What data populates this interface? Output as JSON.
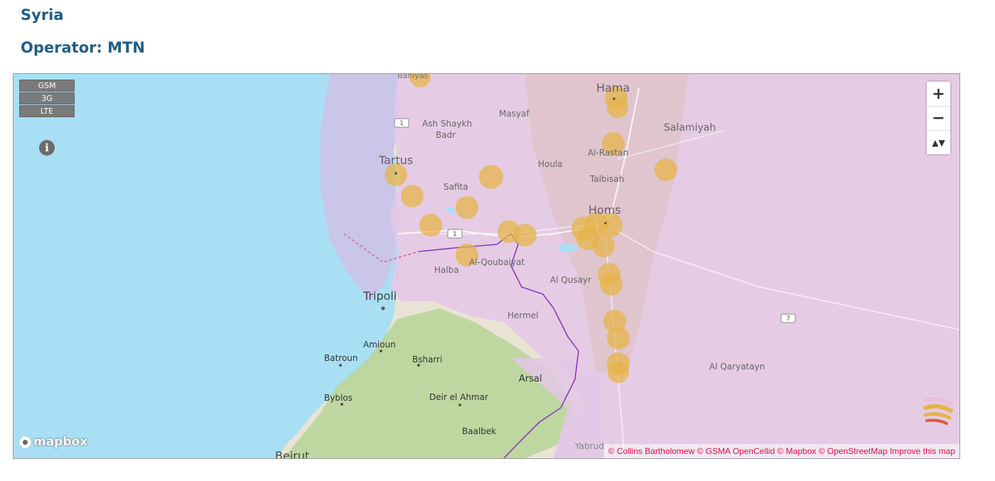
{
  "header": {
    "country": "Syria",
    "operator": "Operator: MTN"
  },
  "map": {
    "tech_buttons": [
      "GSM",
      "3G",
      "LTE"
    ],
    "info_glyph": "i",
    "zoom": {
      "in": "+",
      "out": "−",
      "compass": "▲▼"
    },
    "logo_text": "mapbox",
    "attribution": {
      "collins": "© Collins Bartholomew",
      "gsma": "© GSMA OpenCellid",
      "mapbox": "© Mapbox",
      "osm": "© OpenStreetMap",
      "improve": "Improve this map"
    },
    "places": {
      "baniyas": "Baniyas",
      "hama": "Hama",
      "masyaf": "Masyaf",
      "ash_shaykh_badr_1": "Ash Shaykh",
      "ash_shaykh_badr_2": "Badr",
      "salamiyah": "Salamiyah",
      "tartus": "Tartus",
      "al_rastan": "Al-Rastan",
      "houla": "Houla",
      "talbisah": "Talbisah",
      "safita": "Safita",
      "homs": "Homs",
      "al_qoubaiyat": "Al-Qoubaiyat",
      "halba": "Halba",
      "al_qusayr": "Al Qusayr",
      "tripoli": "Tripoli",
      "hermel": "Hermel",
      "amioun": "Amioun",
      "batroun": "Batroun",
      "bsharri": "Bsharri",
      "arsal": "Arsal",
      "al_qaryatayn": "Al Qaryatayn",
      "byblos": "Byblos",
      "deir_el_ahmar": "Deir el Ahmar",
      "baalbek": "Baalbek",
      "yabrud": "Yabrud",
      "beirut_partial": "Beirut"
    },
    "road_shields": {
      "r1a": "1",
      "r1b": "1",
      "r7": "7"
    },
    "colors": {
      "sea": "#a8dff4",
      "coverage_overlay": "#e4c8e6",
      "coverage_offshore": "#c9c6ea",
      "cell_circle": "#e6b44a",
      "border": "#8a3bbd",
      "header": "#1f5e8a",
      "attribution": "#e0103f"
    }
  }
}
